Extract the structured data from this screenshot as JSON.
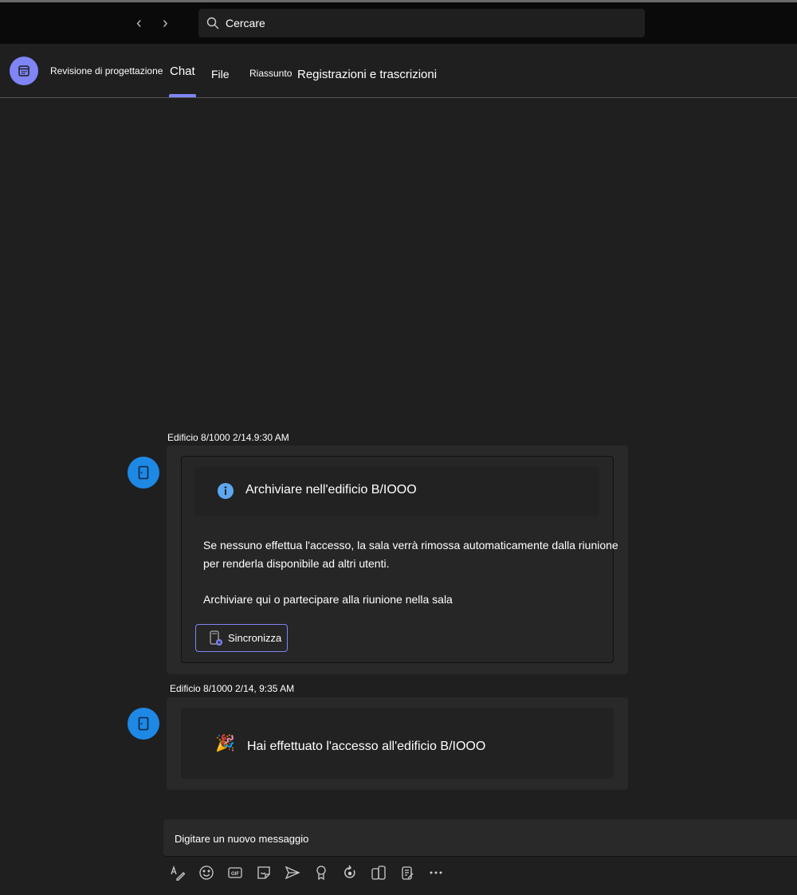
{
  "search": {
    "placeholder": "Cercare"
  },
  "header": {
    "meeting_title": "Revisione di progettazione",
    "tabs": [
      {
        "label": "Chat",
        "active": true
      },
      {
        "label": "File"
      },
      {
        "label": "Riassunto"
      },
      {
        "label": "Registrazioni e trascrizioni"
      }
    ]
  },
  "colors": {
    "accent": "#7f85f5",
    "avatar": "#1e88e5",
    "info": "#5ea7f0"
  },
  "messages": [
    {
      "timestamp": "Edificio 8/1000 2/14.9:30 AM",
      "title": "Archiviare nell'edificio B/IOOO",
      "body_line1": "Se nessuno effettua l'accesso, la sala verrà rimossa automaticamente dalla riunione",
      "body_line2": "per renderla disponibile ad altri utenti.",
      "prompt": "Archiviare qui o partecipare alla riunione nella sala",
      "button": "Sincronizza"
    },
    {
      "timestamp": "Edificio 8/1000 2/14, 9:35 AM",
      "text": "Hai effettuato l'accesso all'edificio B/IOOO"
    }
  ],
  "composer": {
    "placeholder": "Digitare un nuovo messaggio"
  },
  "toolbar": [
    "format-icon",
    "emoji-icon",
    "gif-icon",
    "sticker-icon",
    "send-schedule-icon",
    "praise-icon",
    "loop-icon",
    "apps-icon",
    "notes-icon",
    "more-icon"
  ]
}
